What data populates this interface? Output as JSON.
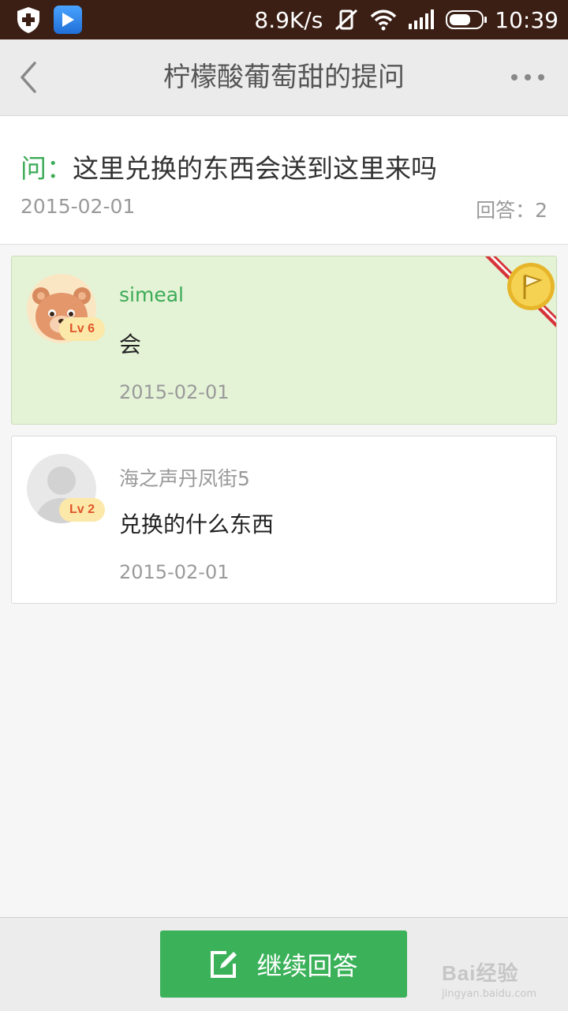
{
  "status_bar": {
    "speed": "8.9K/s",
    "time": "10:39",
    "icons": [
      "shield-icon",
      "play-app-icon",
      "vibrate-off-icon",
      "wifi-icon",
      "signal-icon",
      "battery-icon"
    ]
  },
  "header": {
    "title": "柠檬酸葡萄甜的提问",
    "back_icon": "chevron-left-icon",
    "more_icon": "more-dots-icon"
  },
  "question": {
    "prefix": "问：",
    "text": "这里兑换的东西会送到这里来吗",
    "date": "2015-02-01",
    "answer_count": "回答：2"
  },
  "answers": [
    {
      "user": "simeal",
      "level": "Lv 6",
      "text": "会",
      "date": "2015-02-01",
      "best": true
    },
    {
      "user": "海之声丹凤街5",
      "level": "Lv 2",
      "text": "兑换的什么东西",
      "date": "2015-02-01",
      "best": false
    }
  ],
  "bottom": {
    "reply_label": "继续回答",
    "watermark_main": "Bai经验",
    "watermark_sub": "jingyan.baidu.com"
  },
  "colors": {
    "accent_green": "#3bab57",
    "best_card_bg": "#e4f3d6",
    "status_bar_bg": "#3b1f14",
    "level_badge_bg": "#fce8a8"
  }
}
